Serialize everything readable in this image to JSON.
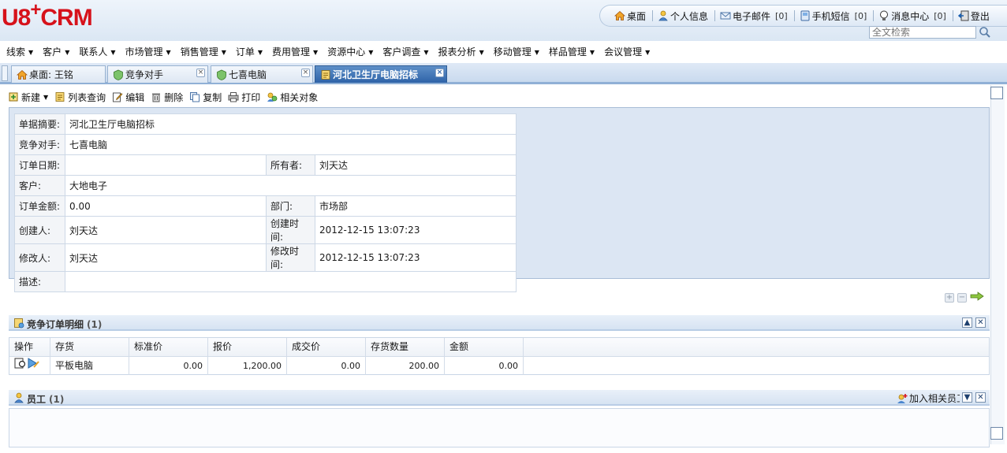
{
  "header": {
    "logo_text": "U8",
    "logo_plus": "+",
    "logo_crm": "CRM",
    "links": [
      {
        "label": "桌面",
        "count": ""
      },
      {
        "label": "个人信息",
        "count": ""
      },
      {
        "label": "电子邮件",
        "count": "[0]"
      },
      {
        "label": "手机短信",
        "count": "[0]"
      },
      {
        "label": "消息中心",
        "count": "[0]"
      },
      {
        "label": "登出",
        "count": ""
      }
    ],
    "search_placeholder": "全文检索"
  },
  "menu": [
    "线索",
    "客户",
    "联系人",
    "市场管理",
    "销售管理",
    "订单",
    "费用管理",
    "资源中心",
    "客户调查",
    "报表分析",
    "移动管理",
    "样品管理",
    "会议管理"
  ],
  "tabs": [
    {
      "label": "桌面: 王铭"
    },
    {
      "label": "竞争对手"
    },
    {
      "label": "七喜电脑"
    },
    {
      "label": "河北卫生厅电脑招标"
    }
  ],
  "toolbar": {
    "new": "新建",
    "list_query": "列表查询",
    "edit": "编辑",
    "delete": "删除",
    "copy": "复制",
    "print": "打印",
    "related": "相关对象"
  },
  "detail": {
    "summary_label": "单据摘要:",
    "summary": "河北卫生厅电脑招标",
    "competitor_label": "竞争对手:",
    "competitor": "七喜电脑",
    "order_date_label": "订单日期:",
    "order_date": "",
    "owner_label": "所有者:",
    "owner": "刘天达",
    "customer_label": "客户:",
    "customer": "大地电子",
    "amount_label": "订单金额:",
    "amount": "0.00",
    "dept_label": "部门:",
    "dept": "市场部",
    "creator_label": "创建人:",
    "creator": "刘天达",
    "created_label": "创建时间:",
    "created": "2012-12-15 13:07:23",
    "modifier_label": "修改人:",
    "modifier": "刘天达",
    "modified_label": "修改时间:",
    "modified": "2012-12-15 13:07:23",
    "desc_label": "描述:",
    "desc": ""
  },
  "order_section": {
    "title": "竞争订单明细",
    "count": "(1)",
    "columns": [
      "操作",
      "存货",
      "标准价",
      "报价",
      "成交价",
      "存货数量",
      "金额"
    ],
    "rows": [
      {
        "item": "平板电脑",
        "std_price": "0.00",
        "quote": "1,200.00",
        "deal": "0.00",
        "qty": "200.00",
        "amount": "0.00"
      }
    ]
  },
  "employee_section": {
    "title": "员工",
    "count": "(1)",
    "add_label": "加入相关员工"
  }
}
